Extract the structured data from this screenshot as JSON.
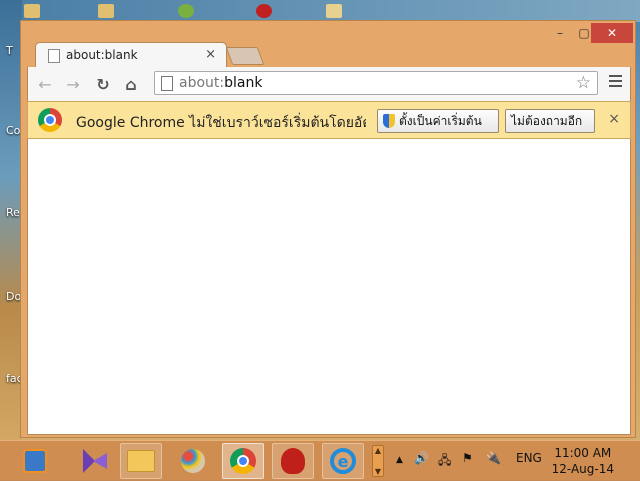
{
  "desktop": {
    "labels": [
      "T",
      "Co",
      "Re",
      "Do",
      "fac"
    ]
  },
  "window": {
    "controls": {
      "minimize": "–",
      "maximize": "▢",
      "close": "✕"
    }
  },
  "tab": {
    "title": "about:blank",
    "close": "×"
  },
  "toolbar": {
    "back": "←",
    "forward": "→",
    "reload": "↻",
    "home": "⌂",
    "url_scheme": "about:",
    "url_rest": "blank",
    "star": "☆"
  },
  "infobar": {
    "message": "Google Chrome ไม่ใช่เบราว์เซอร์เริ่มต้นโดยอัตโ...",
    "set_default_label": "ตั้งเป็นค่าเริ่มต้น",
    "dont_ask_label": "ไม่ต้องถามอีก",
    "close": "×"
  },
  "taskbar": {
    "language": "ENG",
    "time": "11:00 AM",
    "date": "12-Aug-14",
    "tray_up": "▲",
    "volume": "🔊",
    "network": "🖧",
    "flag": "⚑",
    "power": "🔌"
  },
  "colors": {
    "accent": "#e6a86a",
    "infobar": "#fbe49a",
    "close_button": "#c9463d"
  }
}
